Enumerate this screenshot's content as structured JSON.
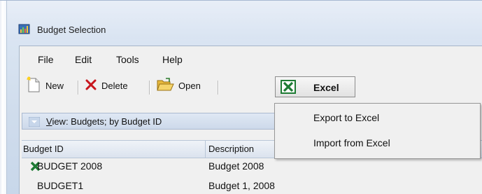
{
  "window": {
    "title": "Budget Selection"
  },
  "menubar": {
    "items": [
      "File",
      "Edit",
      "Tools",
      "Help"
    ]
  },
  "toolbar": {
    "new_label": "New",
    "delete_label": "Delete",
    "open_label": "Open",
    "excel_label": "Excel"
  },
  "excel_menu": {
    "items": [
      "Export to Excel",
      "Import from Excel"
    ]
  },
  "view": {
    "label": "View: Budgets; by Budget ID"
  },
  "grid": {
    "columns": [
      "Budget ID",
      "Description"
    ],
    "rows": [
      {
        "id": "BUDGET 2008",
        "description": "Budget 2008",
        "icon": "excel-icon"
      },
      {
        "id": "BUDGET1",
        "description": "Budget 1, 2008",
        "icon": ""
      }
    ]
  },
  "colors": {
    "excel_green": "#1e7b34",
    "delete_red": "#c8161d",
    "selection_blue": "#cfe0f5"
  }
}
